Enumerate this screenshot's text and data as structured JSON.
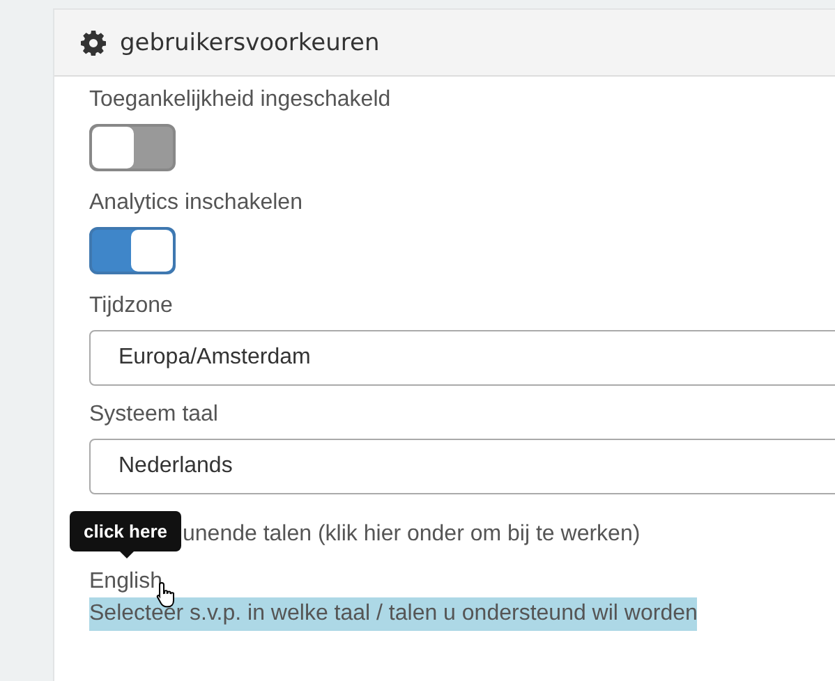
{
  "panel": {
    "title": "gebruikersvoorkeuren"
  },
  "toggles": [
    {
      "label": "Toegankelijkheid ingeschakeld",
      "on": false
    },
    {
      "label": "Analytics inschakelen",
      "on": true
    }
  ],
  "selects": [
    {
      "label": "Tijdzone",
      "value": "Europa/Amsterdam"
    },
    {
      "label": "Systeem taal",
      "value": "Nederlands"
    }
  ],
  "languages": {
    "label": "unende talen (klik hier onder om bij te werken)",
    "tooltip": "click here",
    "items": [
      "English"
    ],
    "hint": "Selecteer s.v.p. in welke taal / talen u ondersteund wil worden"
  }
}
